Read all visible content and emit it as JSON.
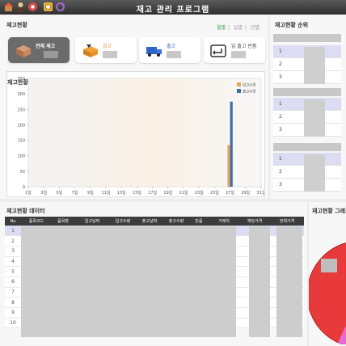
{
  "app": {
    "title": "재고 관리 프로그램"
  },
  "toolbar": {
    "icons": [
      "home-icon",
      "user-icon",
      "settings-icon",
      "lock-icon",
      "refresh-icon"
    ]
  },
  "summary": {
    "title": "재고현황",
    "cards": [
      {
        "label": "전체 재고",
        "icon": "box-icon"
      },
      {
        "label": "입고",
        "icon": "incoming-box-icon"
      },
      {
        "label": "출고",
        "icon": "truck-icon"
      },
      {
        "label": "입 출고 반품",
        "icon": "return-icon"
      }
    ],
    "tabs": [
      "월별",
      "일별",
      "년별"
    ]
  },
  "chart": {
    "title": "재고현황"
  },
  "chart_data": {
    "type": "bar",
    "categories": [
      "1일",
      "3일",
      "5일",
      "7일",
      "9일",
      "11일",
      "13일",
      "15일",
      "17일",
      "19일",
      "21일",
      "23일",
      "25일",
      "27일",
      "29일",
      "31일"
    ],
    "series": [
      {
        "name": "입고수량",
        "color": "#e8a35c",
        "values": [
          0,
          0,
          0,
          0,
          0,
          0,
          0,
          0,
          0,
          0,
          0,
          0,
          0,
          135,
          0,
          0
        ]
      },
      {
        "name": "출고수량",
        "color": "#3d6ea8",
        "values": [
          0,
          0,
          0,
          0,
          0,
          0,
          0,
          0,
          0,
          0,
          0,
          0,
          0,
          275,
          0,
          0
        ]
      }
    ],
    "yticks": [
      0,
      50,
      100,
      150,
      200,
      250,
      300,
      350
    ],
    "ylim": [
      0,
      350
    ],
    "legend": "top-right",
    "grid": false
  },
  "ranking": {
    "title": "재고현황 순위",
    "groups": [
      {
        "rows": [
          "1",
          "2",
          "3"
        ]
      },
      {
        "rows": [
          "1",
          "2",
          "3"
        ]
      },
      {
        "rows": [
          "1",
          "2",
          "3"
        ]
      }
    ]
  },
  "table": {
    "title": "재고현황 데이터",
    "columns": [
      "No",
      "품목코드",
      "품목명",
      "입고날짜",
      "입고수량",
      "출고날짜",
      "출고수량",
      "반품",
      "거래처",
      "재당가격",
      "전체가격"
    ],
    "rows": [
      "1",
      "2",
      "3",
      "4",
      "5",
      "6",
      "7",
      "8",
      "9",
      "10"
    ]
  },
  "pie": {
    "title": "재고현황 그래프"
  }
}
